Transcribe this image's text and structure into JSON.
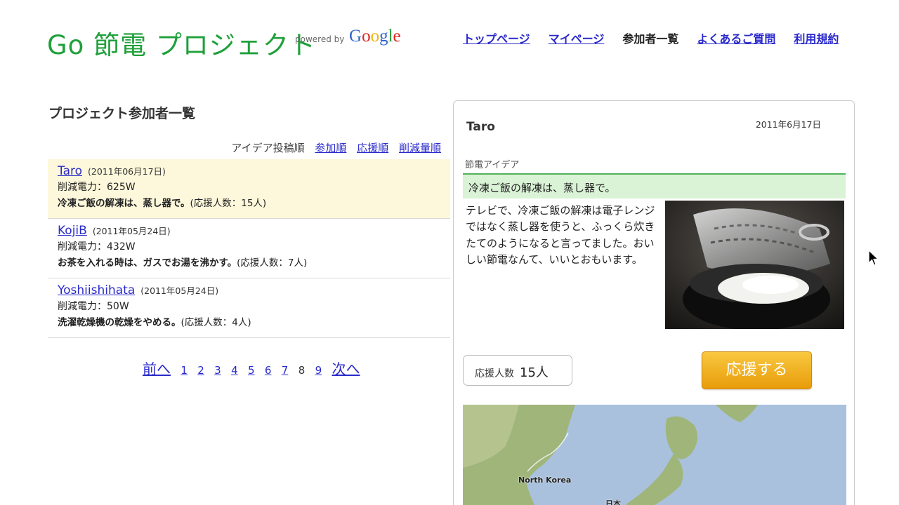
{
  "header": {
    "logo": "Go 節電 プロジェクト",
    "powered_by": "powered by",
    "google_brand": [
      "G",
      "o",
      "o",
      "g",
      "l",
      "e"
    ],
    "google_colors": [
      "#3366cc",
      "#d9281f",
      "#f2b407",
      "#3366cc",
      "#2a9d3f",
      "#d9281f"
    ],
    "nav": [
      {
        "label": "トップページ",
        "link": true
      },
      {
        "label": "マイページ",
        "link": true
      },
      {
        "label": "参加者一覧",
        "link": false
      },
      {
        "label": "よくあるご質問",
        "link": true
      },
      {
        "label": "利用規約",
        "link": true
      }
    ]
  },
  "list": {
    "title": "プロジェクト参加者一覧",
    "sort": {
      "active": "アイデア投稿順",
      "links": [
        "参加順",
        "応援順",
        "削減量順"
      ]
    },
    "entries": [
      {
        "name": "Taro",
        "date": "(2011年06月17日)",
        "power": "削減電力：625W",
        "idea": "冷凍ご飯の解凍は、蒸し器で。",
        "supporters": "(応援人数：15人)"
      },
      {
        "name": "KojiB",
        "date": "(2011年05月24日)",
        "power": "削減電力：432W",
        "idea": "お茶を入れる時は、ガスでお湯を沸かす。",
        "supporters": "(応援人数：7人)"
      },
      {
        "name": "Yoshiishihata",
        "date": "(2011年05月24日)",
        "power": "削減電力：50W",
        "idea": "洗濯乾燥機の乾燥をやめる。",
        "supporters": "(応援人数：4人)"
      }
    ],
    "pager": {
      "prev": "前へ",
      "next": "次へ",
      "pages": [
        "1",
        "2",
        "3",
        "4",
        "5",
        "6",
        "7",
        "8",
        "9"
      ],
      "current": "8"
    }
  },
  "detail": {
    "user": "Taro",
    "date": "2011年6月17日",
    "section_label": "節電アイデア",
    "headline": "冷凍ご飯の解凍は、蒸し器で。",
    "description": "テレビで、冷凍ご飯の解凍は電子レンジではなく蒸し器を使うと、ふっくら炊きたてのようになると言ってました。おいしい節電なんて、いいとおもいます。",
    "supporters_label": "応援人数",
    "supporters_value": "15人",
    "support_button": "応援する",
    "map": {
      "label_north_korea": "North Korea",
      "label_japan": "日本"
    }
  }
}
